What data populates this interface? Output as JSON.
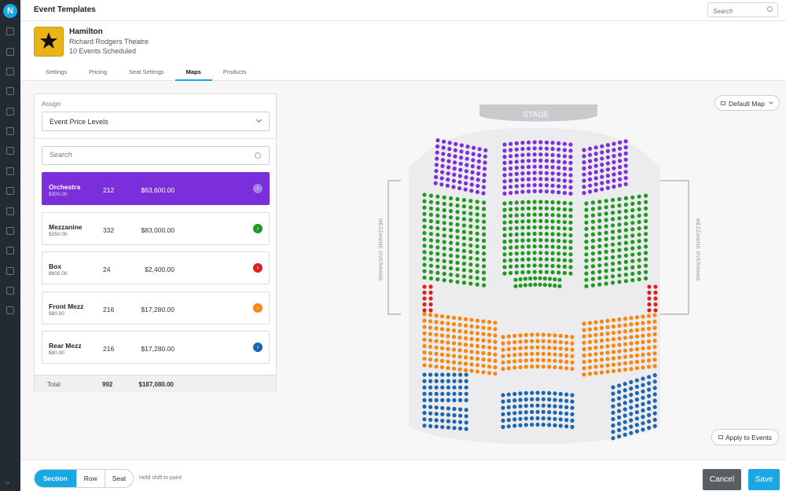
{
  "app": {
    "logo_letter": "N"
  },
  "header": {
    "title": "Event Templates",
    "search_placeholder": "Search"
  },
  "event": {
    "name": "Hamilton",
    "venue": "Richard Rodgers Theatre",
    "scheduled": "10 Events Scheduled"
  },
  "tabs": [
    {
      "label": "Settings",
      "active": false
    },
    {
      "label": "Pricing",
      "active": false
    },
    {
      "label": "Seat Settings",
      "active": false
    },
    {
      "label": "Maps",
      "active": true
    },
    {
      "label": "Products",
      "active": false
    }
  ],
  "assign": {
    "label": "Assign",
    "selected": "Event Price Levels",
    "search_placeholder": "Search"
  },
  "price_levels": [
    {
      "name": "Orchestra",
      "price": "$300.00",
      "seats": "212",
      "total": "$63,600.00",
      "color": "#7b2fdb",
      "active": true
    },
    {
      "name": "Mezzanine",
      "price": "$250.00",
      "seats": "332",
      "total": "$83,000.00",
      "color": "#1e9a1e",
      "active": false
    },
    {
      "name": "Box",
      "price": "$600.00",
      "seats": "24",
      "total": "$2,400.00",
      "color": "#e02020",
      "active": false
    },
    {
      "name": "Front Mezz",
      "price": "$80.00",
      "seats": "216",
      "total": "$17,280.00",
      "color": "#f7870f",
      "active": false
    },
    {
      "name": "Rear Mezz",
      "price": "$80.00",
      "seats": "216",
      "total": "$17,280.00",
      "color": "#1b66b0",
      "active": false
    }
  ],
  "totals": {
    "label": "Total",
    "seats": "992",
    "sum": "$187,080.00"
  },
  "map": {
    "stage_label": "STAGE",
    "left_side_label": "MEZZANINE OVERHANG",
    "right_side_label": "MEZZANINE OVERHANG",
    "default_map_label": "Default Map",
    "apply_label": "Apply to Events"
  },
  "footer": {
    "modes": [
      {
        "label": "Section",
        "active": true
      },
      {
        "label": "Row",
        "active": false
      },
      {
        "label": "Seat",
        "active": false
      }
    ],
    "hint": "Hold shift to paint",
    "cancel_label": "Cancel",
    "save_label": "Save"
  }
}
